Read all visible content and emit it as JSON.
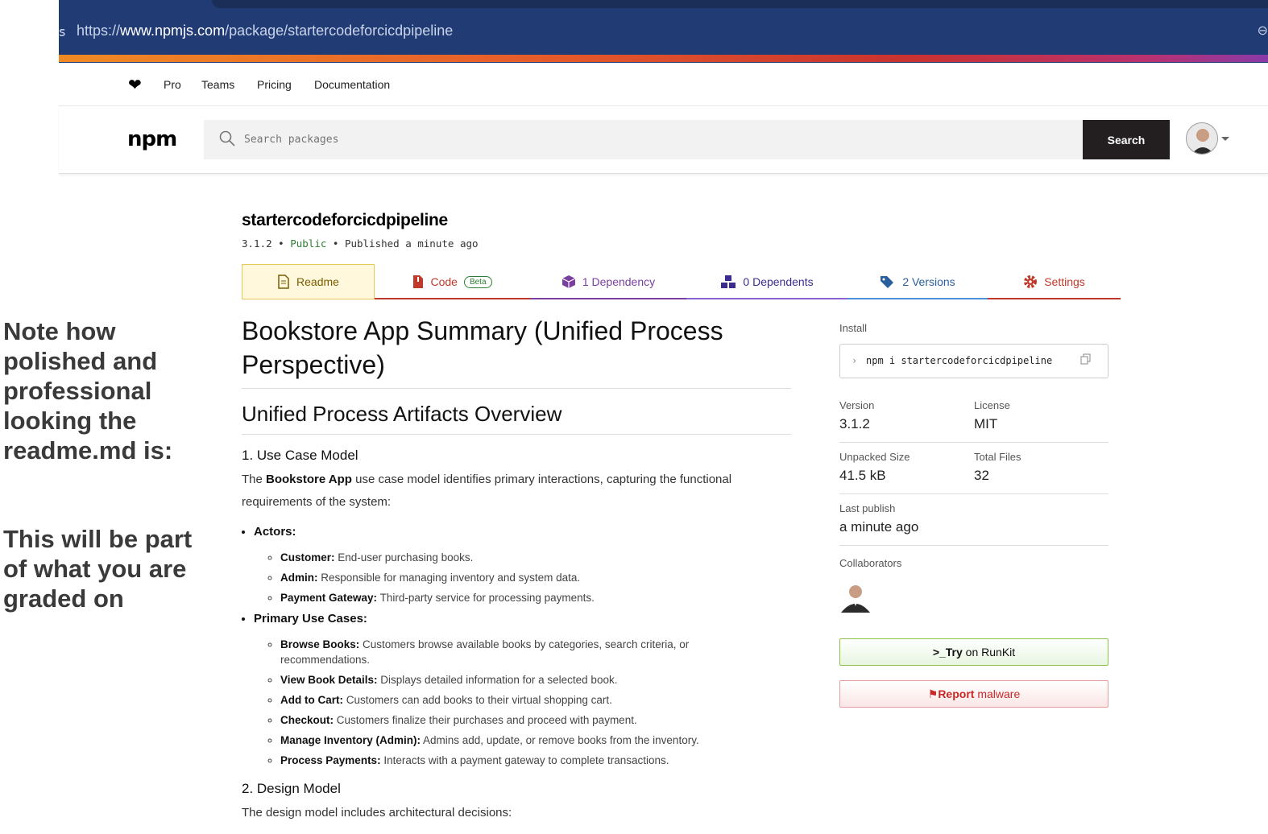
{
  "annotation": {
    "line1": "Note how polished and professional looking the readme.md is:",
    "line2": "This will be part of what you are graded on"
  },
  "browser": {
    "url_prefix": "https://",
    "url_domain": "www.npmjs.com",
    "url_path": "/package/startercodeforcicdpipeline"
  },
  "topnav": {
    "pro": "Pro",
    "teams": "Teams",
    "pricing": "Pricing",
    "documentation": "Documentation"
  },
  "header": {
    "logo": "npm",
    "search_placeholder": "Search packages",
    "search_button": "Search"
  },
  "package": {
    "name": "startercodeforcicdpipeline",
    "version": "3.1.2",
    "visibility": "Public",
    "published": "Published a minute ago"
  },
  "tabs": {
    "readme": "Readme",
    "code": "Code",
    "beta": "Beta",
    "dependency": "1 Dependency",
    "dependents": "0 Dependents",
    "versions": "2 Versions",
    "settings": "Settings"
  },
  "readme": {
    "h1": "Bookstore App Summary (Unified Process Perspective)",
    "h2": "Unified Process Artifacts Overview",
    "section1": "1. Use Case Model",
    "intro_pre": "The ",
    "intro_bold": "Bookstore App",
    "intro_post": " use case model identifies primary interactions, capturing the functional requirements of the system:",
    "actors_title": "Actors:",
    "actors": [
      {
        "term": "Customer:",
        "desc": " End-user purchasing books."
      },
      {
        "term": "Admin:",
        "desc": " Responsible for managing inventory and system data."
      },
      {
        "term": "Payment Gateway:",
        "desc": " Third-party service for processing payments."
      }
    ],
    "usecases_title": "Primary Use Cases:",
    "usecases": [
      {
        "term": "Browse Books:",
        "desc": " Customers browse available books by categories, search criteria, or recommendations."
      },
      {
        "term": "View Book Details:",
        "desc": " Displays detailed information for a selected book."
      },
      {
        "term": "Add to Cart:",
        "desc": " Customers can add books to their virtual shopping cart."
      },
      {
        "term": "Checkout:",
        "desc": " Customers finalize their purchases and proceed with payment."
      },
      {
        "term": "Manage Inventory (Admin):",
        "desc": " Admins add, update, or remove books from the inventory."
      },
      {
        "term": "Process Payments:",
        "desc": " Interacts with a payment gateway to complete transactions."
      }
    ],
    "section2": "2. Design Model",
    "section2_text": "The design model includes architectural decisions:"
  },
  "sidebar": {
    "install_label": "Install",
    "install_cmd": "npm i startercodeforcicdpipeline",
    "version_label": "Version",
    "version": "3.1.2",
    "license_label": "License",
    "license": "MIT",
    "size_label": "Unpacked Size",
    "size": "41.5 kB",
    "files_label": "Total Files",
    "files": "32",
    "last_label": "Last publish",
    "last": "a minute ago",
    "collab_label": "Collaborators",
    "runkit_try": "Try",
    "runkit_rest": " on RunKit",
    "report_bold": "Report",
    "report_rest": " malware"
  },
  "colors": {
    "public": "#2e7d32",
    "readme_tab": "#7a5c00",
    "code_tab": "#c0392b",
    "dependency_tab": "#7b3fa0",
    "dependents_tab": "#3d2b8f",
    "versions_tab": "#2a5f9e",
    "settings_tab": "#c0392b"
  }
}
